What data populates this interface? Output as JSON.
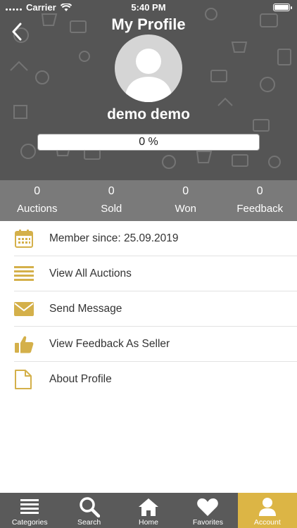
{
  "status_bar": {
    "carrier": "Carrier",
    "time": "5:40 PM"
  },
  "header": {
    "title": "My Profile",
    "user_name": "demo demo",
    "progress_text": "0 %",
    "progress_value": 0
  },
  "stats": [
    {
      "value": "0",
      "label": "Auctions"
    },
    {
      "value": "0",
      "label": "Sold"
    },
    {
      "value": "0",
      "label": "Won"
    },
    {
      "value": "0",
      "label": "Feedback"
    }
  ],
  "menu": [
    {
      "label": "Member since: 25.09.2019",
      "icon": "calendar-icon"
    },
    {
      "label": "View All Auctions",
      "icon": "list-icon"
    },
    {
      "label": "Send Message",
      "icon": "envelope-icon"
    },
    {
      "label": "View Feedback As Seller",
      "icon": "thumbs-up-icon"
    },
    {
      "label": "About Profile",
      "icon": "document-icon"
    }
  ],
  "tabs": [
    {
      "label": "Categories",
      "icon": "categories-icon",
      "active": false
    },
    {
      "label": "Search",
      "icon": "search-icon",
      "active": false
    },
    {
      "label": "Home",
      "icon": "home-icon",
      "active": false
    },
    {
      "label": "Favorites",
      "icon": "heart-icon",
      "active": false
    },
    {
      "label": "Account",
      "icon": "account-icon",
      "active": true
    }
  ],
  "colors": {
    "header_bg": "#555555",
    "stats_bg": "#7a7a7a",
    "accent": "#dcb545",
    "icon_gold": "#d4b04a",
    "tabbar_bg": "#5a5a5a"
  }
}
